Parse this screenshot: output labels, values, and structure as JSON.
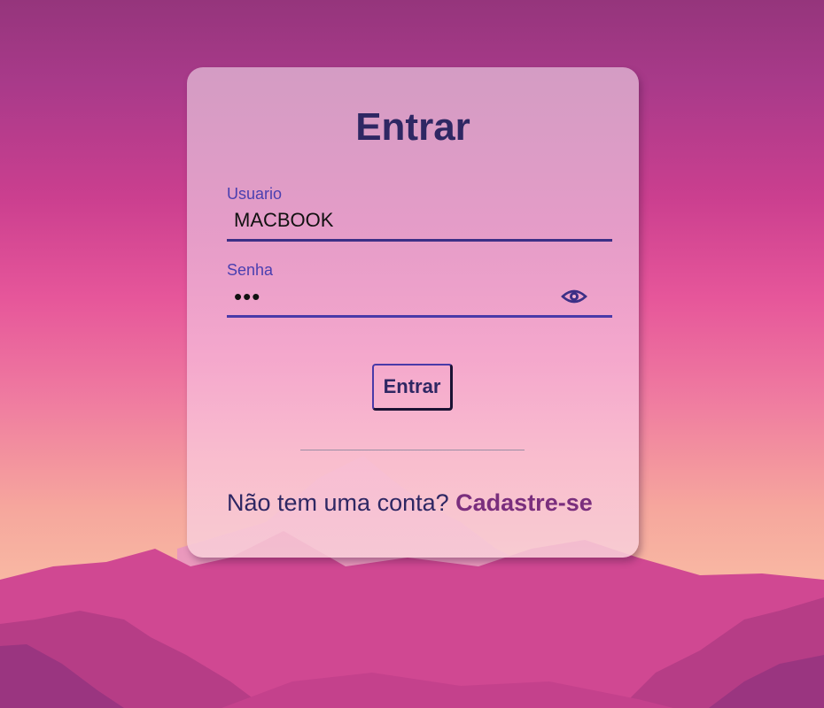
{
  "login": {
    "title": "Entrar",
    "username": {
      "label": "Usuario",
      "value": "MACBOOK"
    },
    "password": {
      "label": "Senha",
      "value": "•••",
      "toggle_icon": "eye-icon"
    },
    "submit_label": "Entrar",
    "signup": {
      "prompt": "Não tem uma conta?",
      "link_label": "Cadastre-se"
    }
  },
  "colors": {
    "title": "#2e2763",
    "field_label": "#4a3fb0",
    "link": "#7a2e7d",
    "background_top": "#95357c",
    "background_bottom": "#f8b8a3"
  }
}
